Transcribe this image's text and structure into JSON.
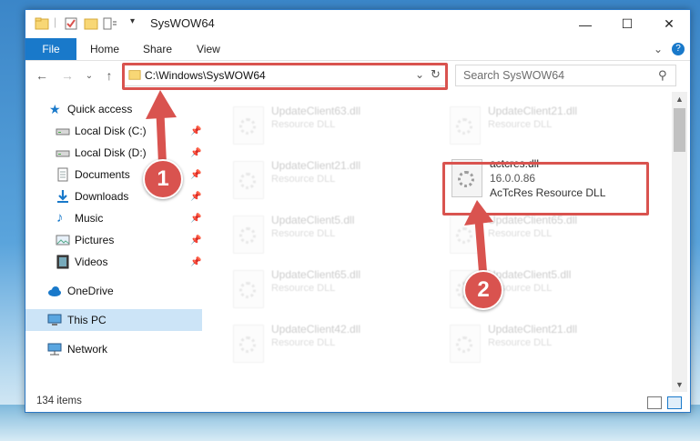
{
  "window": {
    "title": "SysWOW64",
    "controls": {
      "minimize": "—",
      "maximize": "☐",
      "close": "✕"
    }
  },
  "ribbon": {
    "tabs": [
      "File",
      "Home",
      "Share",
      "View"
    ],
    "expand": "⌄",
    "help": "?"
  },
  "nav": {
    "back": "←",
    "forward": "→",
    "recent": "⌄",
    "up": "↑",
    "address": "C:\\Windows\\SysWOW64",
    "address_dropdown": "⌄",
    "refresh": "↻",
    "search_placeholder": "Search SysWOW64",
    "search_icon": "⚲"
  },
  "sidebar": {
    "items": [
      {
        "label": "Quick access",
        "icon": "star-icon",
        "pinned": false
      },
      {
        "label": "Local Disk (C:)",
        "icon": "drive-icon",
        "pinned": true
      },
      {
        "label": "Local Disk (D:)",
        "icon": "drive-icon",
        "pinned": true
      },
      {
        "label": "Documents",
        "icon": "documents-icon",
        "pinned": true
      },
      {
        "label": "Downloads",
        "icon": "downloads-icon",
        "pinned": true
      },
      {
        "label": "Music",
        "icon": "music-icon",
        "pinned": true
      },
      {
        "label": "Pictures",
        "icon": "pictures-icon",
        "pinned": true
      },
      {
        "label": "Videos",
        "icon": "videos-icon",
        "pinned": true
      },
      {
        "label": "OneDrive",
        "icon": "cloud-icon",
        "pinned": false
      },
      {
        "label": "This PC",
        "icon": "computer-icon",
        "pinned": false,
        "selected": true
      },
      {
        "label": "Network",
        "icon": "network-icon",
        "pinned": false
      }
    ],
    "pin_glyph": "📌"
  },
  "files": {
    "left": [
      {
        "name": "UpdateClient63.dll",
        "type": "Resource DLL"
      },
      {
        "name": "UpdateClient21.dll",
        "type": "Resource DLL"
      },
      {
        "name": "UpdateClient5.dll",
        "type": "Resource DLL"
      },
      {
        "name": "UpdateClient65.dll",
        "type": "Resource DLL"
      },
      {
        "name": "UpdateClient42.dll",
        "type": "Resource DLL"
      }
    ],
    "right": [
      {
        "name": "UpdateClient21.dll",
        "type": "Resource DLL"
      },
      {
        "name": "actcres.dll",
        "version": "16.0.0.86",
        "type": "AcTcRes Resource DLL",
        "highlighted": true
      },
      {
        "name": "UpdateClient65.dll",
        "type": "Resource DLL"
      },
      {
        "name": "UpdateClient5.dll",
        "type": "Resource DLL"
      },
      {
        "name": "UpdateClient21.dll",
        "type": "Resource DLL"
      }
    ]
  },
  "status": {
    "count": "134 items"
  },
  "annotations": {
    "step1": "1",
    "step2": "2"
  },
  "colors": {
    "accent": "#1979ca",
    "highlight": "#d9534f",
    "selected": "#cce4f7"
  }
}
